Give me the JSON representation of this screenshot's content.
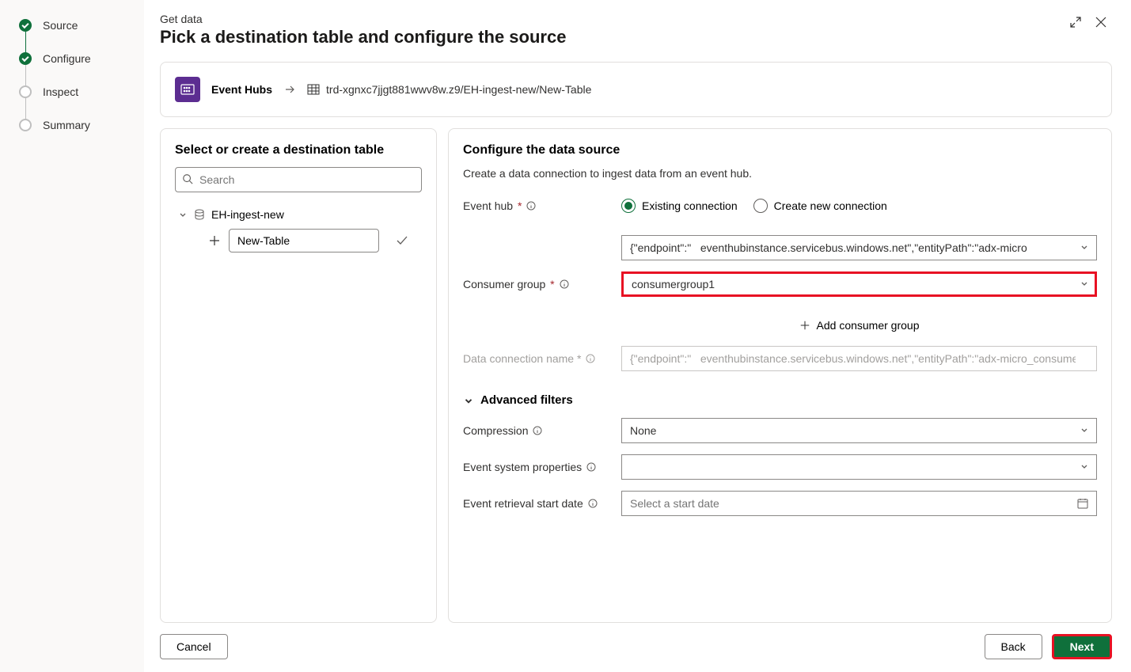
{
  "stepper": {
    "steps": [
      "Source",
      "Configure",
      "Inspect",
      "Summary"
    ]
  },
  "header": {
    "pre": "Get data",
    "title": "Pick a destination table and configure the source"
  },
  "crumb": {
    "source": "Event Hubs",
    "path": "trd-xgnxc7jjgt881wwv8w.z9/EH-ingest-new/New-Table"
  },
  "left": {
    "title": "Select or create a destination table",
    "search_placeholder": "Search",
    "db_name": "EH-ingest-new",
    "new_table": "New-Table"
  },
  "right": {
    "title": "Configure the data source",
    "sub": "Create a data connection to ingest data from an event hub.",
    "eventhub_label": "Event hub",
    "radio_existing": "Existing connection",
    "radio_create": "Create new connection",
    "eventhub_value": "{\"endpoint\":\"   eventhubinstance.servicebus.windows.net\",\"entityPath\":\"adx-micro",
    "consumer_label": "Consumer group",
    "consumer_value": "consumergroup1",
    "add_consumer": "Add consumer group",
    "conn_name_label": "Data connection name",
    "conn_name_value": "{\"endpoint\":\"   eventhubinstance.servicebus.windows.net\",\"entityPath\":\"adx-micro_consume",
    "adv": "Advanced filters",
    "compression_label": "Compression",
    "compression_value": "None",
    "sysprops_label": "Event system properties",
    "sysprops_value": "",
    "startdate_label": "Event retrieval start date",
    "startdate_placeholder": "Select a start date"
  },
  "footer": {
    "cancel": "Cancel",
    "back": "Back",
    "next": "Next"
  }
}
